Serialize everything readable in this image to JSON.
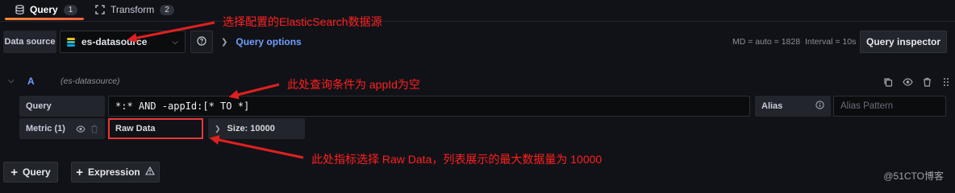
{
  "tabs": [
    {
      "label": "Query",
      "count": "1",
      "icon": "database-icon"
    },
    {
      "label": "Transform",
      "count": "2",
      "icon": "transform-icon"
    }
  ],
  "toolbar": {
    "data_source_label": "Data source",
    "datasource_name": "es-datasource",
    "query_options_label": "Query options",
    "md_text": "MD = auto = 1828",
    "interval_text": "Interval = 10s",
    "query_inspector_label": "Query inspector"
  },
  "query_row": {
    "ref_id": "A",
    "datasource_hint": "(es-datasource)",
    "query_label": "Query",
    "query_value": "*:* AND -appId:[* TO *]",
    "alias_label": "Alias",
    "alias_placeholder": "Alias Pattern",
    "alias_value": "",
    "metric_label": "Metric (1)",
    "metric_value": "Raw Data",
    "size_label": "Size: 10000"
  },
  "bottom": {
    "add_query_label": "Query",
    "add_expression_label": "Expression"
  },
  "annotations": {
    "datasource_note": "选择配置的ElasticSearch数据源",
    "query_note": "此处查询条件为 appId为空",
    "metric_note": "此处指标选择 Raw Data，列表展示的最大数据量为 10000"
  },
  "watermark": "@51CTO博客",
  "colors": {
    "background": "#111217",
    "accent_tab": "#ff8833",
    "link_blue": "#6e9fff",
    "annotation_red": "#ff2020"
  }
}
